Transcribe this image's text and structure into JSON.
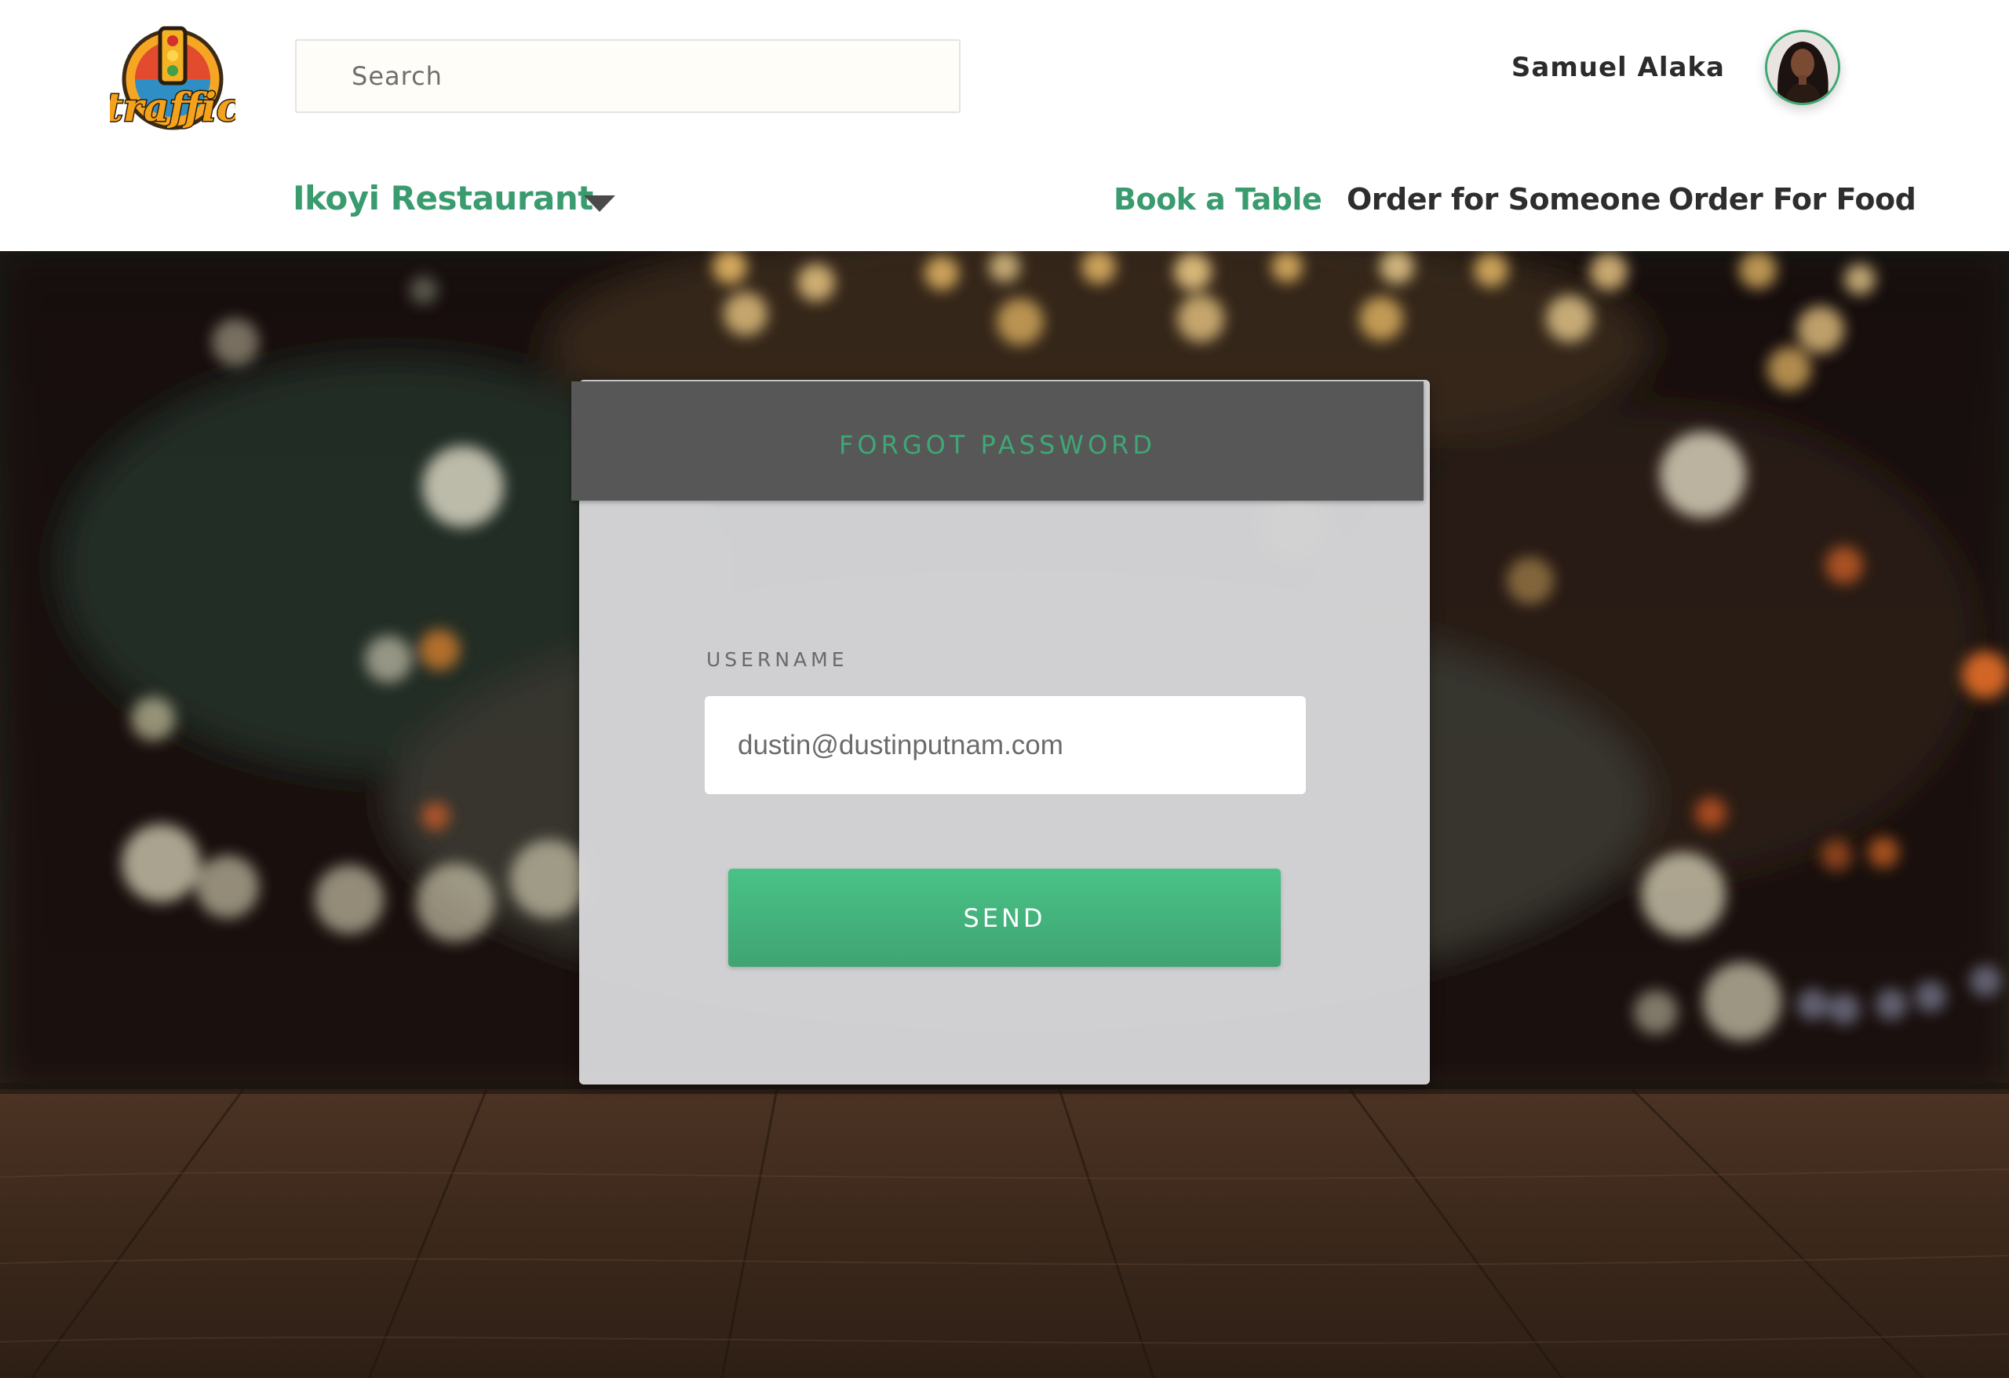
{
  "header": {
    "logo_text": "traffic",
    "search": {
      "placeholder": "Search",
      "value": ""
    },
    "user_name": "Samuel Alaka",
    "restaurant_selector": "Ikoyi Restaurant",
    "nav": [
      {
        "label": "Book a Table",
        "active": true
      },
      {
        "label": "Order for Someone",
        "active": false
      },
      {
        "label": "Order For Food",
        "active": false
      }
    ]
  },
  "icons": {
    "restaurant_dropdown": "chevron-down-icon",
    "avatar": "user-avatar"
  },
  "form": {
    "title": "FORGOT PASSWORD",
    "username_label": "USERNAME",
    "username_value": "dustin@dustinputnam.com",
    "send_label": "SEND"
  },
  "colors": {
    "accent_green": "#3a9b6f",
    "button_green": "#46b882",
    "card_header": "#575757"
  }
}
